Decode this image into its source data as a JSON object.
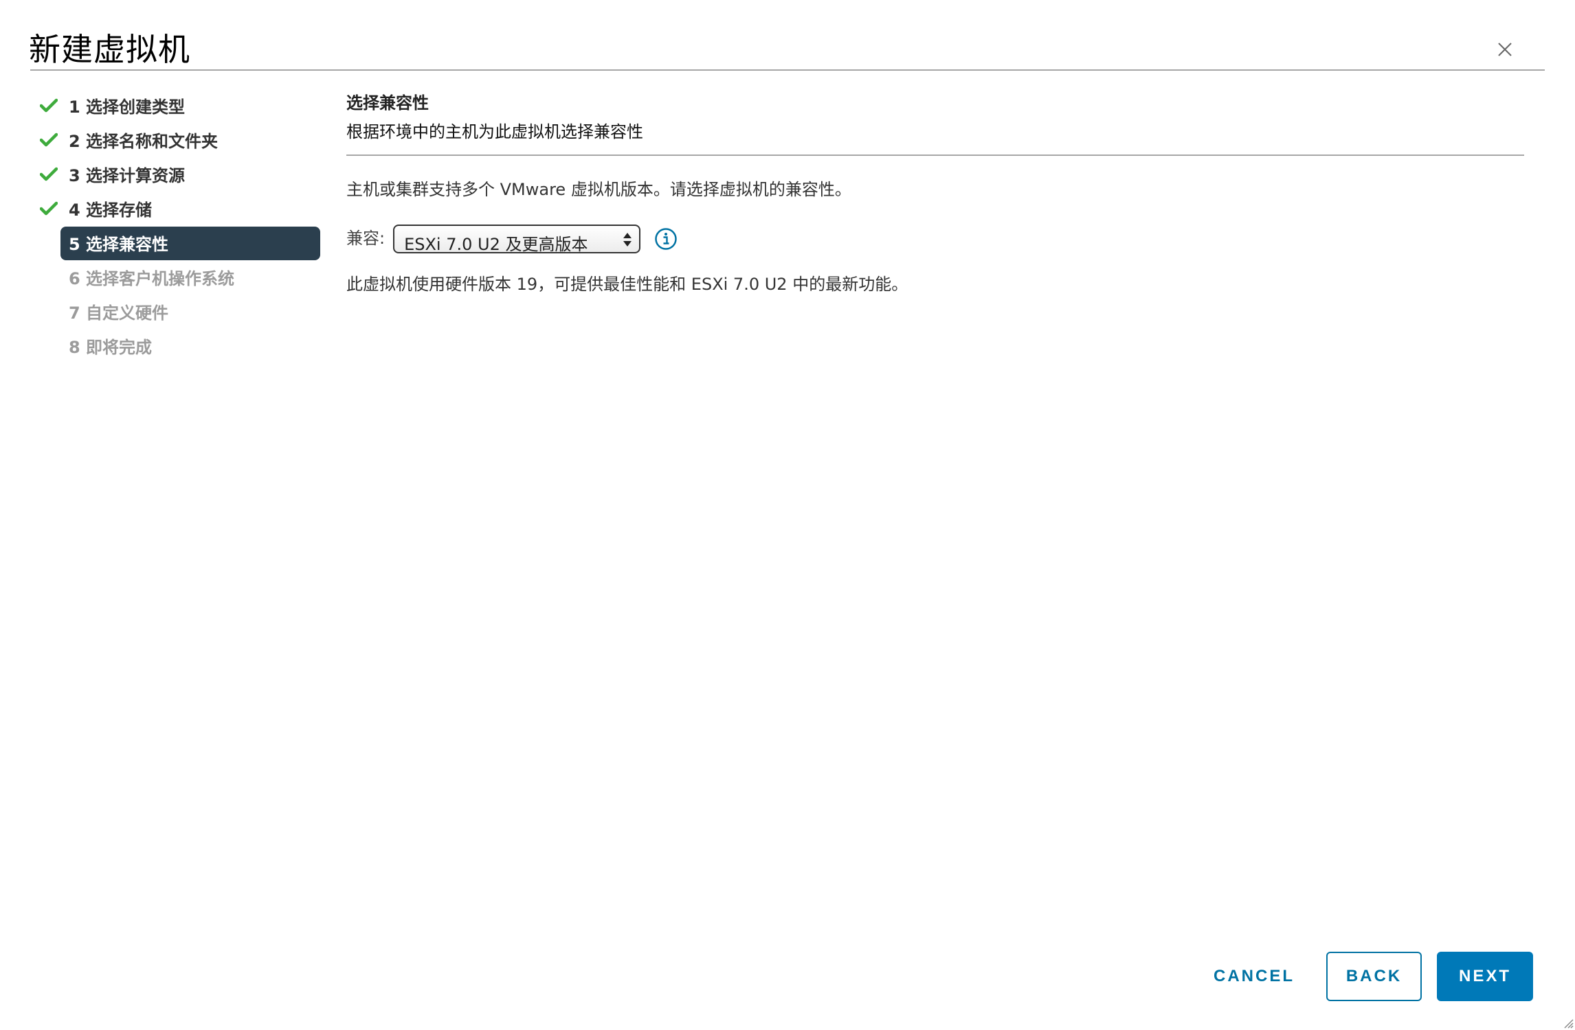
{
  "dialog": {
    "title": "新建虚拟机",
    "close_icon": "close-icon"
  },
  "steps": [
    {
      "label": "1 选择创建类型",
      "state": "completed"
    },
    {
      "label": "2 选择名称和文件夹",
      "state": "completed"
    },
    {
      "label": "3 选择计算资源",
      "state": "completed"
    },
    {
      "label": "4 选择存储",
      "state": "completed"
    },
    {
      "label": "5 选择兼容性",
      "state": "active"
    },
    {
      "label": "6 选择客户机操作系统",
      "state": "pending"
    },
    {
      "label": "7 自定义硬件",
      "state": "pending"
    },
    {
      "label": "8 即将完成",
      "state": "pending"
    }
  ],
  "content": {
    "title": "选择兼容性",
    "subtitle": "根据环境中的主机为此虚拟机选择兼容性",
    "description": "主机或集群支持多个 VMware 虚拟机版本。请选择虚拟机的兼容性。",
    "compat_label": "兼容:",
    "compat_selected": "ESXi 7.0 U2 及更高版本",
    "hardware_note": "此虚拟机使用硬件版本 19，可提供最佳性能和 ESXi 7.0 U2 中的最新功能。"
  },
  "footer": {
    "cancel_label": "CANCEL",
    "back_label": "BACK",
    "next_label": "NEXT"
  },
  "colors": {
    "accent": "#0079b8",
    "active_step_bg": "#2b3f4e",
    "check_green": "#3eab3c",
    "pending_text": "#9b9b9b"
  }
}
